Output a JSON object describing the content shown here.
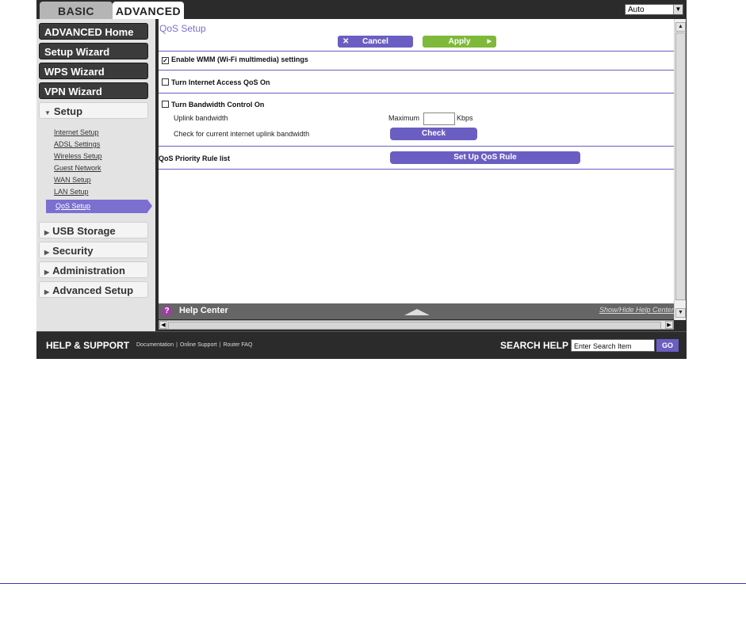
{
  "tabs": {
    "basic": "BASIC",
    "advanced": "ADVANCED"
  },
  "language_select": {
    "value": "Auto",
    "arrow": "▼"
  },
  "sidebar": {
    "main_buttons": [
      "ADVANCED Home",
      "Setup Wizard",
      "WPS Wizard",
      "VPN Wizard"
    ],
    "setup_label": "Setup",
    "setup_links": [
      "Internet Setup",
      "ADSL Settings",
      "Wireless Setup",
      "Guest Network",
      "WAN Setup",
      "LAN Setup"
    ],
    "active_link": "QoS Setup",
    "sections": [
      "USB Storage",
      "Security",
      "Administration",
      "Advanced Setup"
    ]
  },
  "main": {
    "title": "QoS Setup",
    "cancel_label": "Cancel",
    "apply_label": "Apply",
    "wmm_label": "Enable WMM (Wi-Fi multimedia) settings",
    "wmm_checked": "✓",
    "qos_label": "Turn Internet Access QoS On",
    "bandwidth_label": "Turn Bandwidth Control On",
    "uplink_label": "Uplink bandwidth",
    "maximum_label": "Maximum",
    "kbps_label": "Kbps",
    "check_label": "Check for current internet uplink bandwidth",
    "check_button": "Check",
    "priority_label": "QoS Priority Rule list",
    "setup_rule_button": "Set Up QoS Rule"
  },
  "help": {
    "title": "Help Center",
    "toggle": "Show/Hide Help Center",
    "icon": "?"
  },
  "footer": {
    "title": "HELP & SUPPORT",
    "links": [
      "Documentation",
      "Online Support",
      "Router FAQ"
    ],
    "search_label": "SEARCH HELP",
    "search_value": "Enter Search Item",
    "go_label": "GO"
  },
  "colors": {
    "accent": "#6b5ec2",
    "apply": "#7fb93a",
    "dark": "#2b2b2b"
  }
}
